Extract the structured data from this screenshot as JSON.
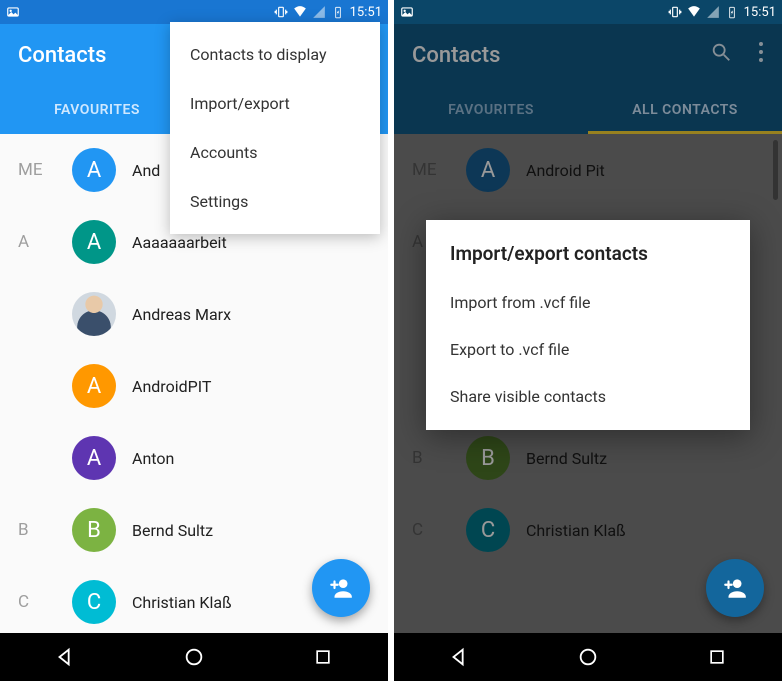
{
  "statusbar": {
    "time": "15:51"
  },
  "app": {
    "title": "Contacts"
  },
  "tabs": {
    "favourites": "FAVOURITES",
    "all": "ALL CONTACTS"
  },
  "header": {
    "me": "ME",
    "a": "A",
    "b": "B",
    "c": "C"
  },
  "contacts": {
    "me": {
      "name": "Android Pit",
      "color": "#2196f3",
      "initial": "A"
    },
    "me_left": "And",
    "a1": {
      "name": "Aaaaaaarbeit",
      "color": "#009688",
      "initial": "A"
    },
    "a2": {
      "name": "Andreas Marx"
    },
    "a3": {
      "name": "AndroidPIT",
      "color": "#ff9800",
      "initial": "A"
    },
    "a4": {
      "name": "Anton",
      "color": "#5e35b1",
      "initial": "A"
    },
    "b1": {
      "name": "Bernd Sultz",
      "color": "#7cb342",
      "initial": "B"
    },
    "c1": {
      "name": "Christian Klaß",
      "color": "#00bcd4",
      "initial": "C"
    }
  },
  "menu": {
    "item1": "Contacts to display",
    "item2": "Import/export",
    "item3": "Accounts",
    "item4": "Settings"
  },
  "dialog": {
    "title": "Import/export contacts",
    "item1": "Import from .vcf file",
    "item2": "Export to .vcf file",
    "item3": "Share visible contacts"
  },
  "colors": {
    "primary": "#2196f3",
    "primary_dim": "#115a86",
    "tab_indicator": "#fdd835"
  }
}
